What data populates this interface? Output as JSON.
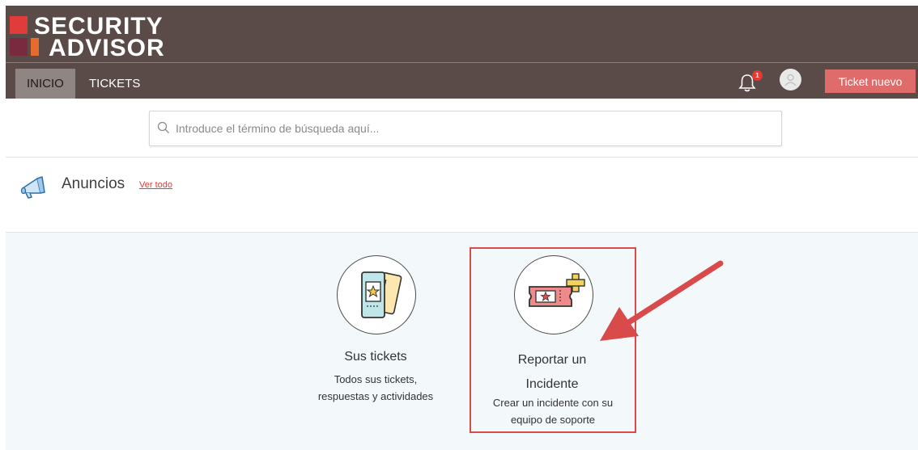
{
  "brand": {
    "line1": "SECURITY",
    "line2": "ADVISOR",
    "colors": {
      "header_bg": "#5a4b48",
      "red": "#e03c3c",
      "maroon": "#7a2a3e",
      "orange": "#e86b2e"
    }
  },
  "nav": {
    "tabs": [
      {
        "label": "INICIO",
        "active": true
      },
      {
        "label": "TICKETS",
        "active": false
      }
    ],
    "notifications_count": "1",
    "new_ticket_label": "Ticket nuevo"
  },
  "search": {
    "placeholder": "Introduce el término de búsqueda aquí...",
    "value": ""
  },
  "announcements": {
    "title": "Anuncios",
    "link_label": "Ver todo"
  },
  "cards": [
    {
      "title": "Sus tickets",
      "description_lines": [
        "Todos sus tickets,",
        "respuestas y actividades"
      ],
      "icon": "tickets-icon"
    },
    {
      "title_lines": [
        "Reportar un",
        "Incidente"
      ],
      "description_lines": [
        "Crear un incidente con su",
        "equipo de soporte"
      ],
      "icon": "add-ticket-icon"
    }
  ],
  "annotation": {
    "highlight_color": "#d94a4a"
  }
}
